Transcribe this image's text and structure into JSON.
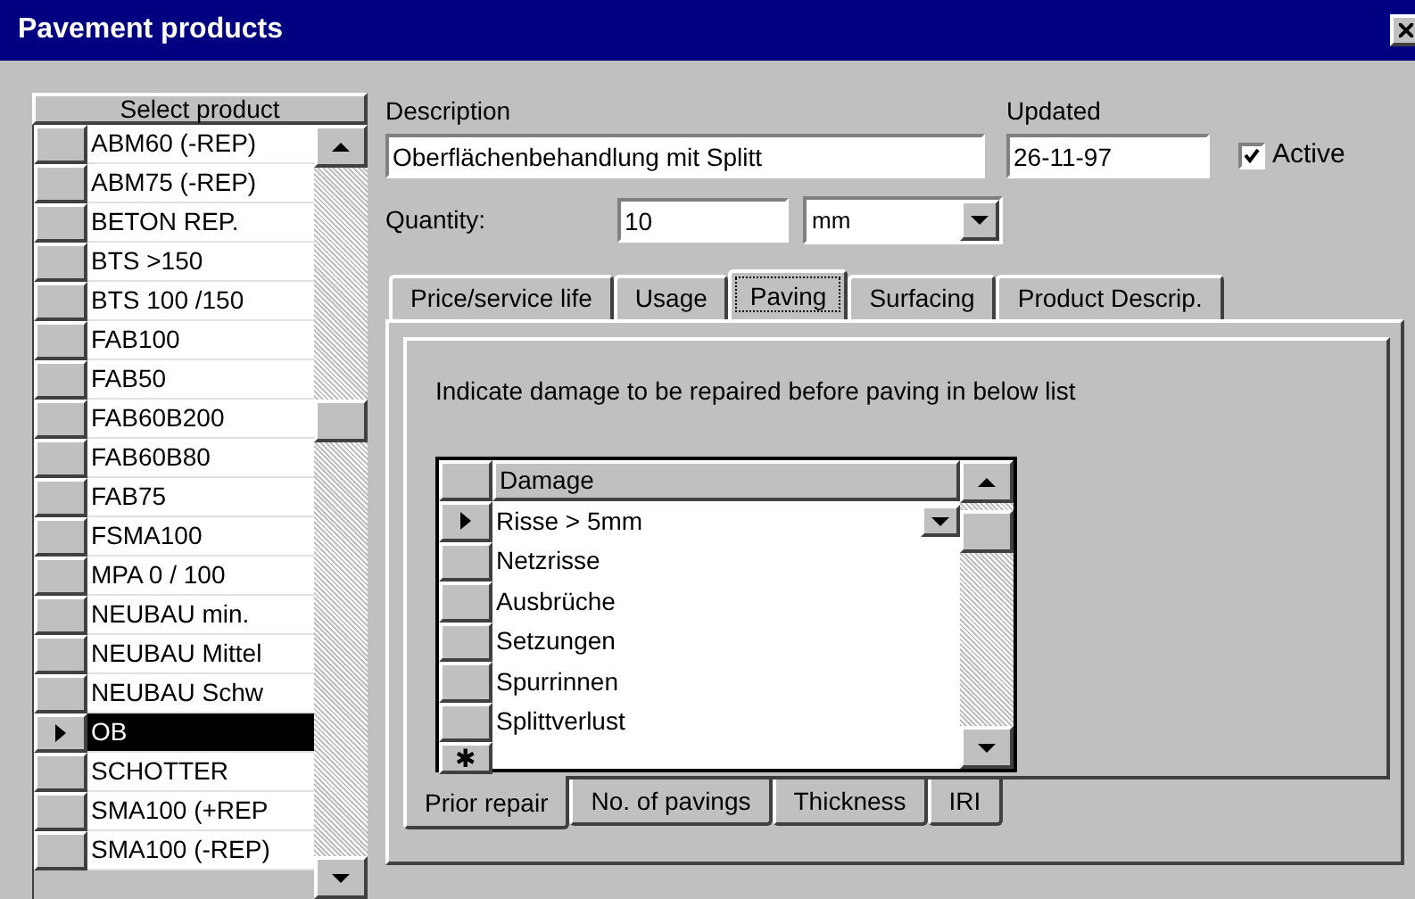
{
  "window": {
    "title": "Pavement products"
  },
  "product_list": {
    "header": "Select product",
    "items": [
      {
        "label": "ABM60 (-REP)",
        "selected": false
      },
      {
        "label": "ABM75 (-REP)",
        "selected": false
      },
      {
        "label": "BETON REP.",
        "selected": false
      },
      {
        "label": "BTS  >150",
        "selected": false
      },
      {
        "label": "BTS 100 /150",
        "selected": false
      },
      {
        "label": "FAB100",
        "selected": false
      },
      {
        "label": "FAB50",
        "selected": false
      },
      {
        "label": "FAB60B200",
        "selected": false
      },
      {
        "label": "FAB60B80",
        "selected": false
      },
      {
        "label": "FAB75",
        "selected": false
      },
      {
        "label": "FSMA100",
        "selected": false
      },
      {
        "label": "MPA 0 / 100",
        "selected": false
      },
      {
        "label": "NEUBAU min.",
        "selected": false
      },
      {
        "label": "NEUBAU Mittel",
        "selected": false
      },
      {
        "label": "NEUBAU Schw",
        "selected": false
      },
      {
        "label": "OB",
        "selected": true
      },
      {
        "label": "SCHOTTER",
        "selected": false
      },
      {
        "label": "SMA100 (+REP",
        "selected": false
      },
      {
        "label": "SMA100 (-REP)",
        "selected": false
      }
    ]
  },
  "description": {
    "label": "Description",
    "value": "Oberflächenbehandlung mit Splitt"
  },
  "updated": {
    "label": "Updated",
    "value": "26-11-97"
  },
  "active": {
    "label": "Active",
    "checked": true
  },
  "quantity": {
    "label": "Quantity:",
    "value": "10",
    "unit": "mm"
  },
  "tabs": [
    {
      "label": "Price/service life",
      "selected": false
    },
    {
      "label": "Usage",
      "selected": false
    },
    {
      "label": "Paving",
      "selected": true
    },
    {
      "label": "Surfacing",
      "selected": false
    },
    {
      "label": "Product Descrip.",
      "selected": false
    }
  ],
  "paving": {
    "instruction": "Indicate damage to be repaired before paving in below list",
    "damage_grid": {
      "header": "Damage",
      "new_row_marker": "✱",
      "rows": [
        {
          "label": "Risse > 5mm",
          "selected": true
        },
        {
          "label": "Netzrisse",
          "selected": false
        },
        {
          "label": "Ausbrüche",
          "selected": false
        },
        {
          "label": "Setzungen",
          "selected": false
        },
        {
          "label": "Spurrinnen",
          "selected": false
        },
        {
          "label": "Splittverlust",
          "selected": false
        }
      ]
    },
    "sub_tabs": [
      {
        "label": "Prior repair",
        "selected": true
      },
      {
        "label": "No. of pavings",
        "selected": false
      },
      {
        "label": "Thickness",
        "selected": false
      },
      {
        "label": "IRI",
        "selected": false
      }
    ]
  }
}
